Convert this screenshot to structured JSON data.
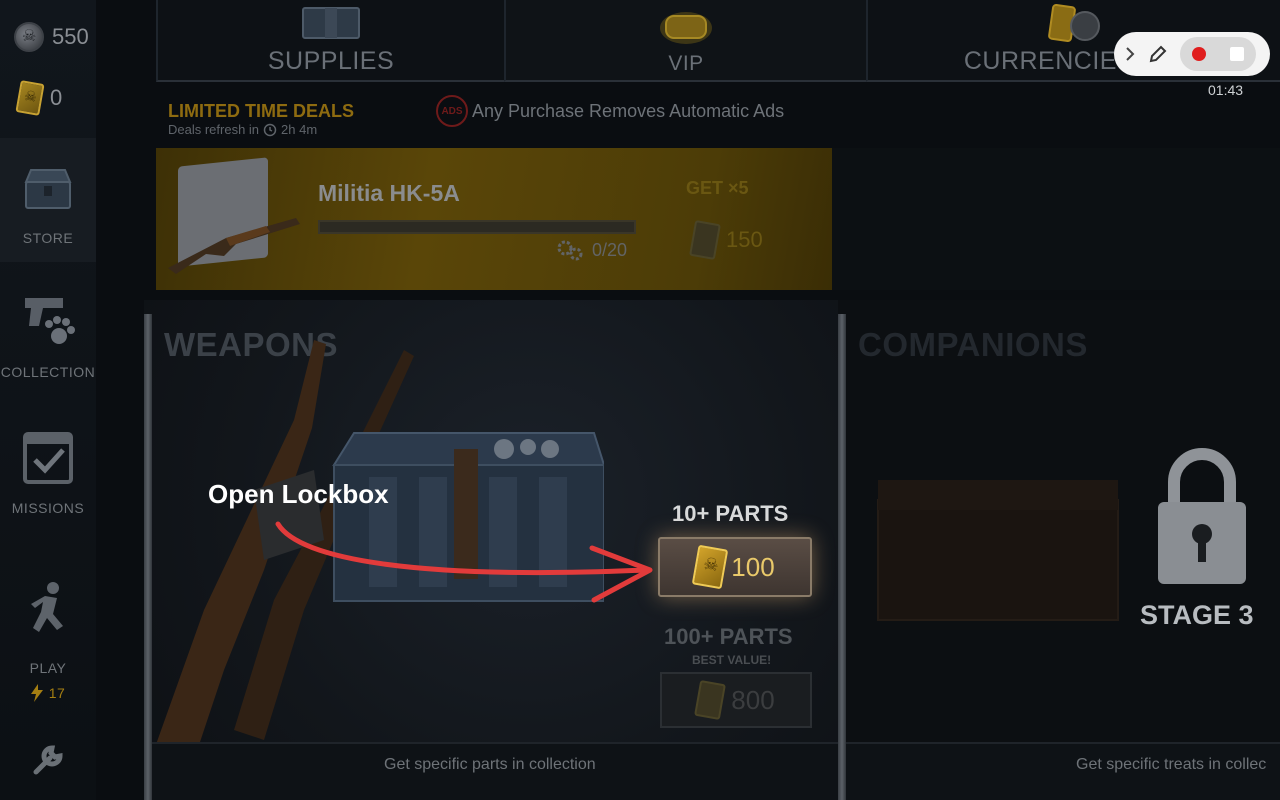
{
  "sidebar": {
    "skull_coins": "550",
    "gold_cards": "0",
    "items": [
      {
        "label": "STORE"
      },
      {
        "label": "COLLECTION"
      },
      {
        "label": "MISSIONS"
      },
      {
        "label": "PLAY",
        "energy": "17"
      }
    ]
  },
  "tabs": [
    {
      "label": "SUPPLIES",
      "icon": "crate-icon"
    },
    {
      "label": "VIP",
      "icon": "gold-bar-icon"
    },
    {
      "label": "CURRENCIES",
      "icon": "card-and-coin-icon"
    }
  ],
  "deals": {
    "title": "LIMITED TIME DEALS",
    "refresh_text": "Deals refresh in",
    "refresh_time": "2h 4m",
    "ads_badge": "ADS",
    "ads_note": "Any Purchase Removes Automatic Ads"
  },
  "deal_banner": {
    "name": "Militia HK-5A",
    "progress_text": "0/20",
    "progress_fraction": 0,
    "get_label": "GET ×5",
    "price": "150"
  },
  "weapons": {
    "title": "WEAPONS",
    "offer1_parts": "10+ PARTS",
    "offer1_price": "100",
    "offer2_parts": "100+ PARTS",
    "offer2_badge": "BEST VALUE!",
    "offer2_price": "800",
    "footer": "Get specific parts in collection"
  },
  "companions": {
    "title": "COMPANIONS",
    "stage": "STAGE 3",
    "footer": "Get specific treats in collec"
  },
  "annotation": {
    "label": "Open Lockbox",
    "color": "#e23b3b"
  },
  "recorder": {
    "time": "01:43"
  }
}
